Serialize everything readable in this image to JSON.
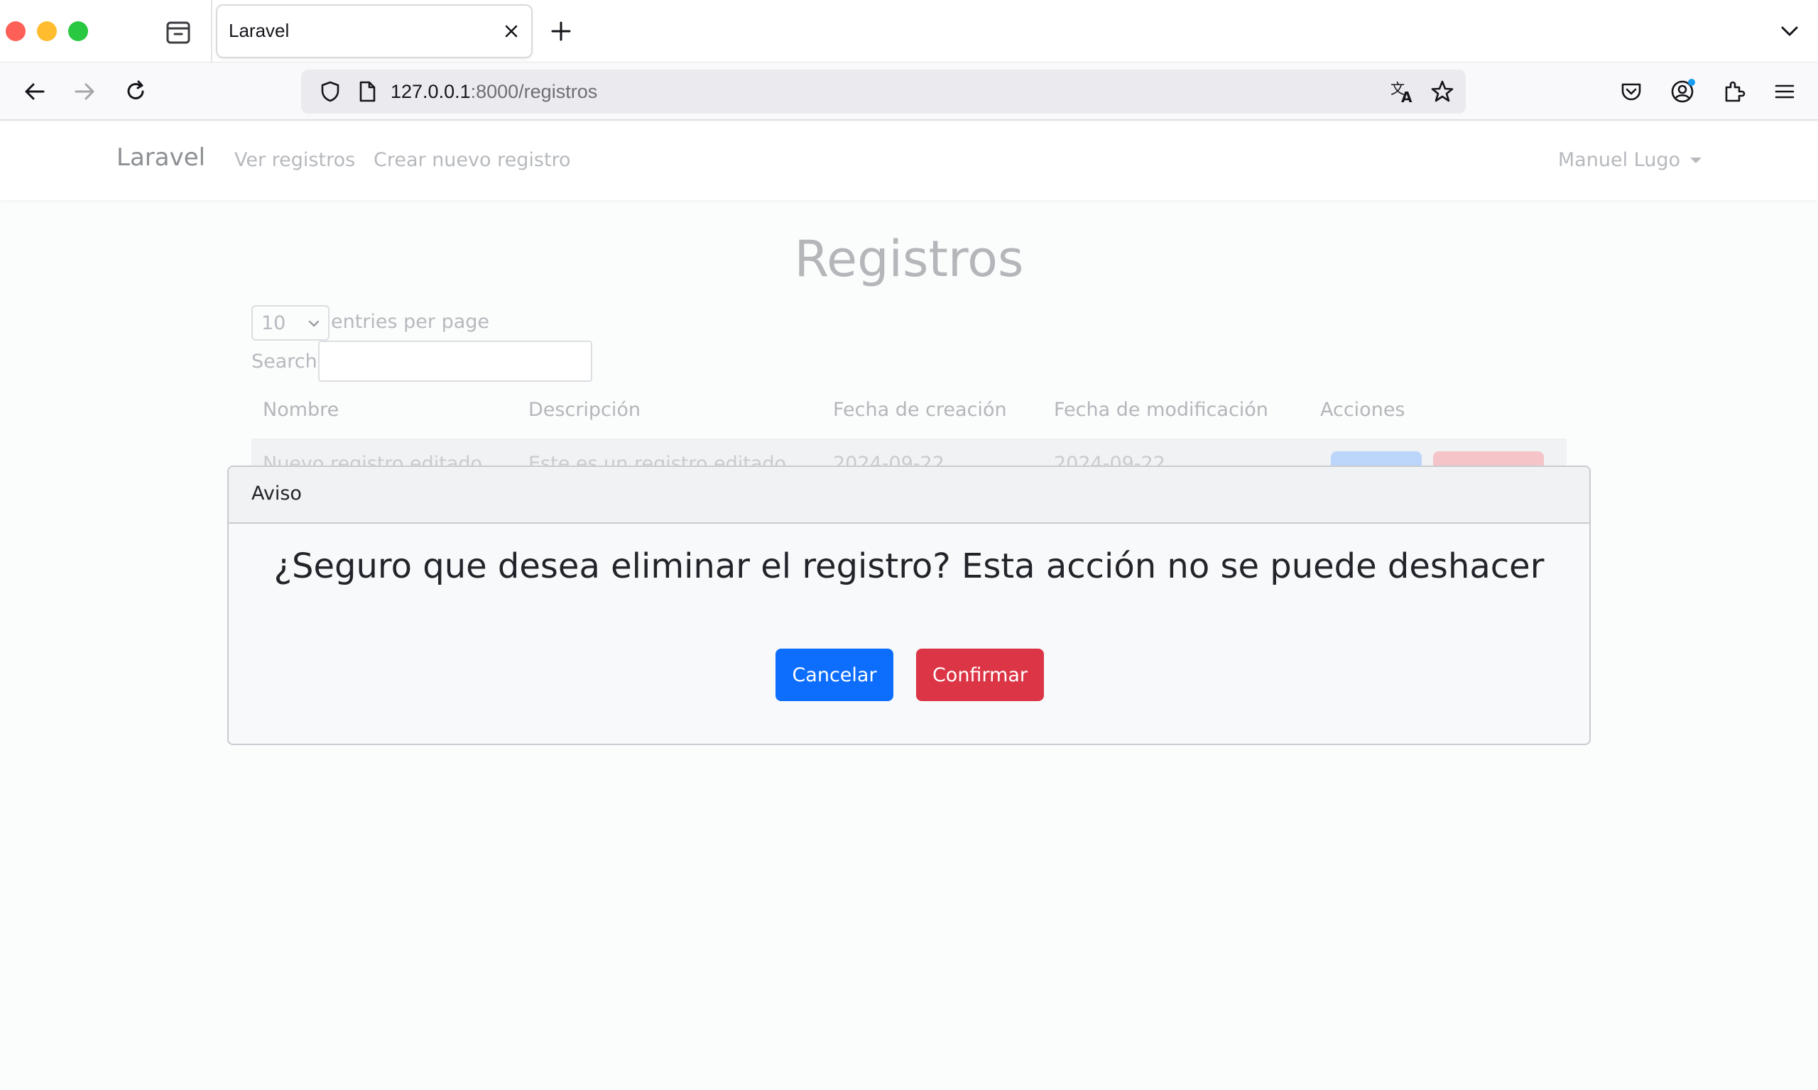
{
  "browser": {
    "tab_title": "Laravel",
    "url_host": "127.0.0.1",
    "url_rest": ":8000/registros"
  },
  "navbar": {
    "brand": "Laravel",
    "links": [
      "Ver registros",
      "Crear nuevo registro"
    ],
    "user": "Manuel Lugo"
  },
  "page": {
    "title": "Registros",
    "entries_value": "10",
    "entries_label": "entries per page",
    "search_label": "Search:"
  },
  "table": {
    "headers": [
      "Nombre",
      "Descripción",
      "Fecha de creación",
      "Fecha de modificación",
      "Acciones"
    ],
    "rows": [
      [
        "Nuevo registro editado",
        "Este es un registro editado",
        "2024-09-22",
        "2024-09-22"
      ]
    ]
  },
  "modal": {
    "title": "Aviso",
    "message": "¿Seguro que desea eliminar el registro? Esta acción no se puede deshacer",
    "cancel": "Cancelar",
    "confirm": "Confirmar"
  },
  "colors": {
    "primary": "#0d6efd",
    "danger": "#dc3545",
    "brand_muted": "#8c8f93"
  }
}
